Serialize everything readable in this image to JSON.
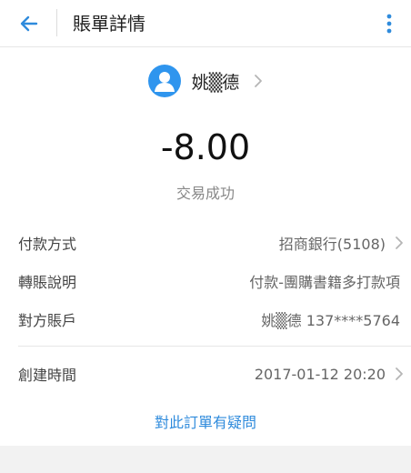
{
  "appbar": {
    "title": "賬單詳情"
  },
  "payee": {
    "name": "姚▒德"
  },
  "transaction": {
    "amount": "-8.00",
    "status": "交易成功"
  },
  "details": {
    "payment_method": {
      "label": "付款方式",
      "value": "招商銀行(5108)"
    },
    "transfer_note": {
      "label": "轉賬說明",
      "value": "付款-團購書籍多打款項"
    },
    "counterparty": {
      "label": "對方賬戶",
      "value": "姚▒德 137****5764"
    },
    "created_time": {
      "label": "創建時間",
      "value": "2017-01-12 20:20"
    }
  },
  "question_link": "對此訂單有疑問",
  "colors": {
    "accent": "#2f8bdc",
    "avatar": "#2f95ee",
    "divider": "#e6e6e6",
    "footer": "#f2f2f2"
  },
  "icons": {
    "back": "arrow-left-icon",
    "more": "more-vertical-icon",
    "avatar": "user-icon",
    "chevron": "chevron-right-icon"
  }
}
